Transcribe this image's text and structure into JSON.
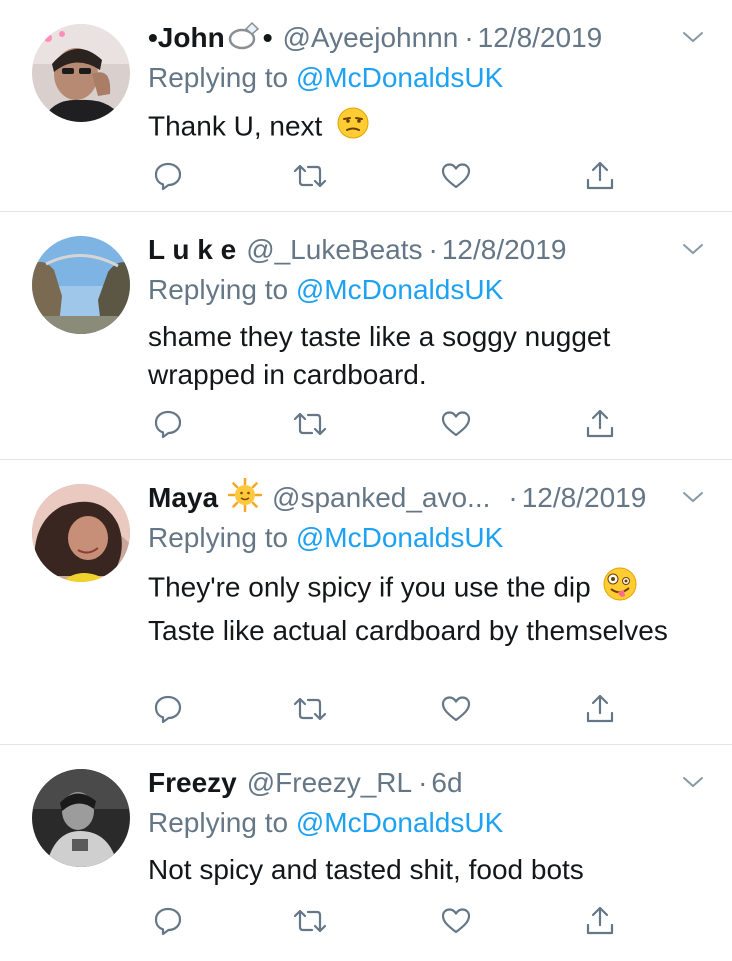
{
  "tweets": [
    {
      "name": "•John",
      "name_suffix": "•",
      "name_emoji": "ring-icon",
      "handle": "@Ayeejohnnn",
      "date": "12/8/2019",
      "replying_prefix": "Replying to",
      "replying_to": "@McDonaldsUK",
      "text": "Thank U, next",
      "text_emoji": "unamused-face-icon"
    },
    {
      "name": "L u k e",
      "handle": "@_LukeBeats",
      "date": "12/8/2019",
      "replying_prefix": "Replying to",
      "replying_to": "@McDonaldsUK",
      "text": "shame they taste like a soggy nugget wrapped in cardboard."
    },
    {
      "name": "Maya",
      "name_emoji": "sun-face-icon",
      "handle": "@spanked_avo...",
      "date": "12/8/2019",
      "replying_prefix": "Replying to",
      "replying_to": "@McDonaldsUK",
      "text_line1": "They're only spicy if you use the dip",
      "text_rest": "Taste like actual cardboard by themselves",
      "text_emoji": "zany-face-icon"
    },
    {
      "name": "Freezy",
      "handle": "@Freezy_RL",
      "date": "6d",
      "replying_prefix": "Replying to",
      "replying_to": "@McDonaldsUK",
      "text": "Not spicy and tasted shit, food bots"
    }
  ],
  "colors": {
    "text": "#14171a",
    "muted": "#657786",
    "link": "#1da1f2",
    "divider": "#e1e4e8"
  },
  "action_icons": [
    "reply-icon",
    "retweet-icon",
    "like-icon",
    "share-icon"
  ]
}
